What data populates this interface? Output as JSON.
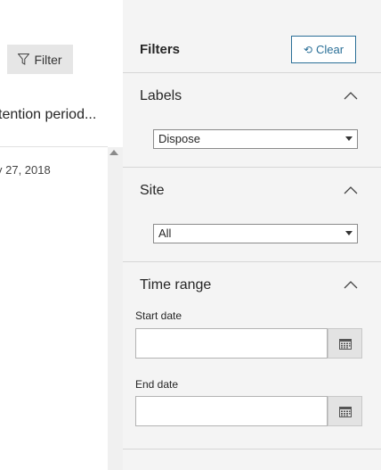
{
  "background": {
    "filter_button": {
      "label": "Filter",
      "icon": "funnel-icon"
    },
    "column_header": "tention period...",
    "rows": [
      {
        "date": "y 27, 2018"
      }
    ]
  },
  "panel": {
    "title": "Filters",
    "clear_button": {
      "label": "Clear",
      "icon": "undo-icon"
    },
    "sections": {
      "labels": {
        "title": "Labels",
        "selected": "Dispose"
      },
      "site": {
        "title": "Site",
        "selected": "All"
      },
      "time_range": {
        "title": "Time range",
        "start_label": "Start date",
        "start_value": "",
        "end_label": "End date",
        "end_value": ""
      }
    }
  },
  "colors": {
    "accent": "#2a6f97",
    "panel_bg": "#f4f4f4"
  }
}
